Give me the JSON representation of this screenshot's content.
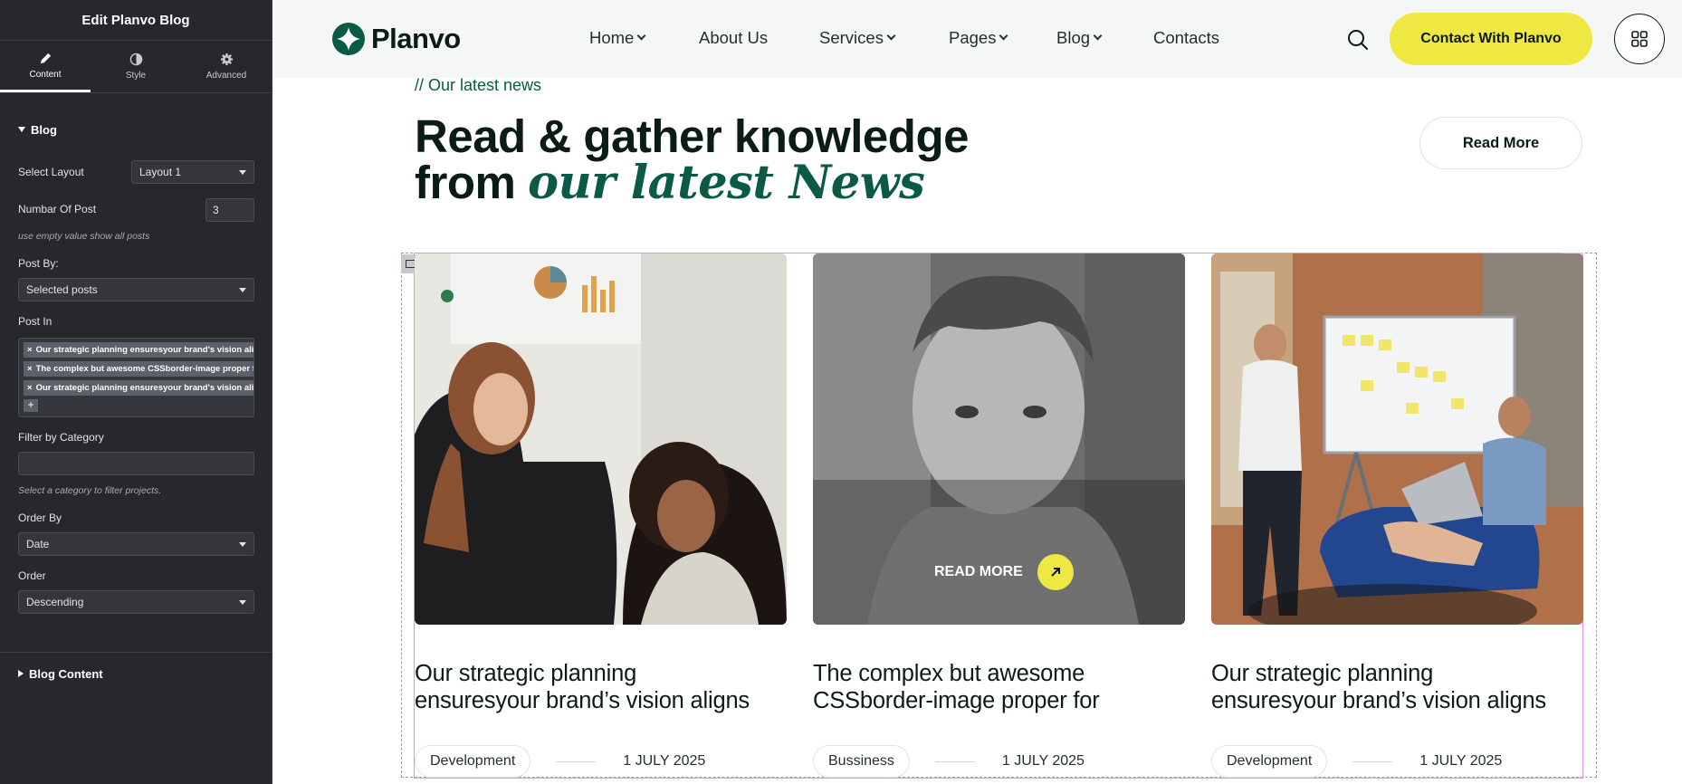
{
  "editor": {
    "title": "Edit Planvo Blog",
    "tabs": [
      {
        "label": "Content",
        "icon": "pencil-icon"
      },
      {
        "label": "Style",
        "icon": "contrast-icon"
      },
      {
        "label": "Advanced",
        "icon": "gear-icon"
      }
    ],
    "section_blog": "Blog",
    "select_layout_label": "Select Layout",
    "select_layout_value": "Layout 1",
    "number_of_post_label": "Numbar Of Post",
    "number_of_post_value": "3",
    "number_help": "use empty value show all posts",
    "post_by_label": "Post By:",
    "post_by_value": "Selected posts",
    "post_in_label": "Post In",
    "post_in_tags": [
      "Our strategic planning ensuresyour brand's vision aligns",
      "The complex but awesome CSSborder-image proper for",
      "Our strategic planning ensuresyour brand's vision aligns"
    ],
    "tag_remove_symbol": "×",
    "tag_add_symbol": "+",
    "filter_label": "Filter by Category",
    "filter_value": "",
    "filter_help": "Select a category to filter projects.",
    "order_by_label": "Order By",
    "order_by_value": "Date",
    "order_label": "Order",
    "order_value": "Descending",
    "section_blog_content": "Blog Content",
    "collapse_symbol": "‹"
  },
  "site": {
    "logo_text": "Planvo",
    "nav": [
      "Home",
      "About Us",
      "Services",
      "Pages",
      "Blog",
      "Contacts"
    ],
    "cta": "Contact With Planvo",
    "eyebrow": "// Our latest news",
    "headline_line1": "Read & gather knowledge",
    "headline_line2_plain": "from ",
    "headline_line2_script": "our latest News",
    "read_more": "Read More",
    "cards": [
      {
        "title_line1": "Our strategic planning",
        "title_line2": "ensuresyour brand’s vision aligns",
        "category": "Development",
        "date": "1 JULY 2025"
      },
      {
        "title_line1": "The complex but awesome",
        "title_line2": "CSSborder-image proper for",
        "category": "Bussiness",
        "date": "1 JULY 2025",
        "overlay": "READ MORE"
      },
      {
        "title_line1": "Our strategic planning",
        "title_line2": "ensuresyour brand’s vision aligns",
        "category": "Development",
        "date": "1 JULY 2025"
      }
    ]
  },
  "colors": {
    "editor_bg": "#26282c",
    "brand_green": "#0a5a45",
    "accent_yellow": "#efe742",
    "selection_pink": "#e28ff0"
  }
}
